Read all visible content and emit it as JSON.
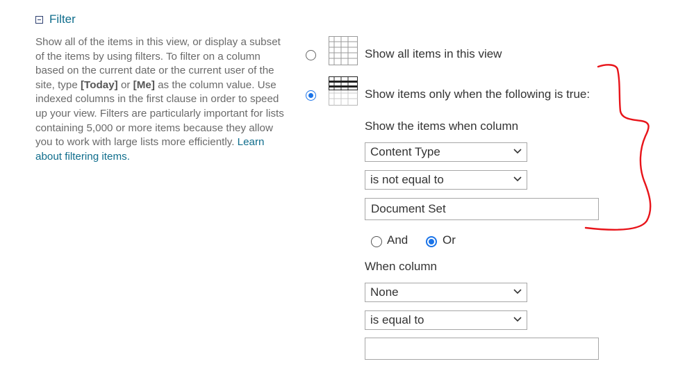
{
  "section": {
    "title": "Filter",
    "icon": "collapse-minus-icon"
  },
  "description": {
    "text1": "Show all of the items in this view, or display a subset of the items by using filters. To filter on a column based on the current date or the current user of the site, type ",
    "today": "[Today]",
    "or": " or ",
    "me": "[Me]",
    "text2": " as the column value. Use indexed columns in the first clause in order to speed up your view. Filters are particularly important for lists containing 5,000 or more items because they allow you to work with large lists more efficiently. ",
    "link": "Learn about filtering items."
  },
  "options": {
    "show_all": {
      "label": "Show all items in this view",
      "selected": false
    },
    "show_filtered": {
      "label": "Show items only when the following is true:",
      "selected": true
    }
  },
  "clause1": {
    "label": "Show the items when column",
    "column": "Content Type",
    "operator": "is not equal to",
    "value": "Document Set"
  },
  "conjunction": {
    "and_label": "And",
    "or_label": "Or",
    "selected": "Or"
  },
  "clause2": {
    "label": "When column",
    "column": "None",
    "operator": "is equal to",
    "value": ""
  },
  "colors": {
    "accent": "#1a73e8",
    "link": "#0f6d8c",
    "annotation": "#e8141a"
  }
}
